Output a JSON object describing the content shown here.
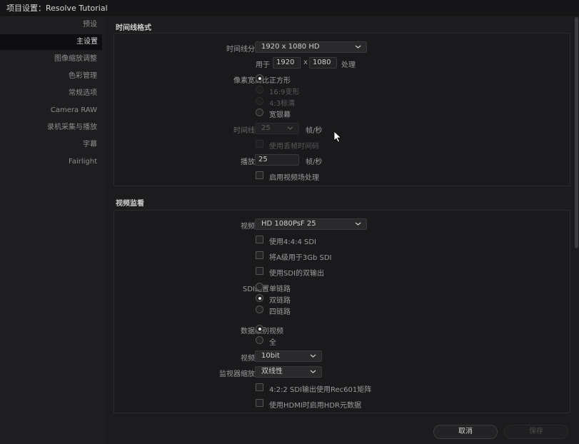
{
  "window": {
    "title": "项目设置：Resolve Tutorial"
  },
  "sidebar": {
    "items": [
      {
        "label": "预设",
        "active": false
      },
      {
        "label": "主设置",
        "active": true
      },
      {
        "label": "图像缩放调整",
        "active": false
      },
      {
        "label": "色彩管理",
        "active": false
      },
      {
        "label": "常规选项",
        "active": false
      },
      {
        "label": "Camera RAW",
        "active": false
      },
      {
        "label": "录机采集与播放",
        "active": false
      },
      {
        "label": "字幕",
        "active": false
      },
      {
        "label": "Fairlight",
        "active": false
      }
    ]
  },
  "timeline_format": {
    "section_title": "时间线格式",
    "resolution_label": "时间线分辨率",
    "resolution_value": "1920 x 1080 HD",
    "for_label": "用于",
    "width": "1920",
    "x_sep": "x",
    "height": "1080",
    "process_label": "处理",
    "pixel_aspect_label": "像素宽高比",
    "pixel_aspect_options": [
      "正方形",
      "16:9变形",
      "4:3标清",
      "宽银幕"
    ],
    "pixel_aspect_selected": "正方形",
    "frame_rate_label": "时间线帧率",
    "frame_rate_value": "25",
    "fps_unit": "帧/秒",
    "drop_frame_label": "使用丢帧时间码",
    "playback_rate_label": "播放帧率",
    "playback_rate_value": "25",
    "playback_fps_unit": "帧/秒",
    "field_processing_label": "启用视频场处理"
  },
  "video_monitoring": {
    "section_title": "视频监看",
    "video_format_label": "视频格式",
    "video_format_value": "HD 1080PsF 25",
    "checks": [
      "使用4:4:4 SDI",
      "将A级用于3Gb SDI",
      "使用SDI的双输出"
    ],
    "sdi_config_label": "SDI配置",
    "sdi_options": [
      "单链路",
      "双链路",
      "四链路"
    ],
    "sdi_selected": "双链路",
    "data_level_label": "数据级别",
    "data_level_options": [
      "视频",
      "全"
    ],
    "data_level_selected": "视频",
    "bit_depth_label": "视频位深",
    "bit_depth_value": "10bit",
    "monitor_scaling_label": "监视器缩放比例",
    "monitor_scaling_value": "双线性",
    "rec601_label": "4:2:2 SDI输出使用Rec601矩阵",
    "hdr_label": "使用HDMI时启用HDR元数据"
  },
  "footer": {
    "cancel_label": "取消",
    "save_label": "保存"
  },
  "icons": {
    "dropdown": "chevron-down-icon",
    "cursor": "mouse-pointer-icon"
  }
}
